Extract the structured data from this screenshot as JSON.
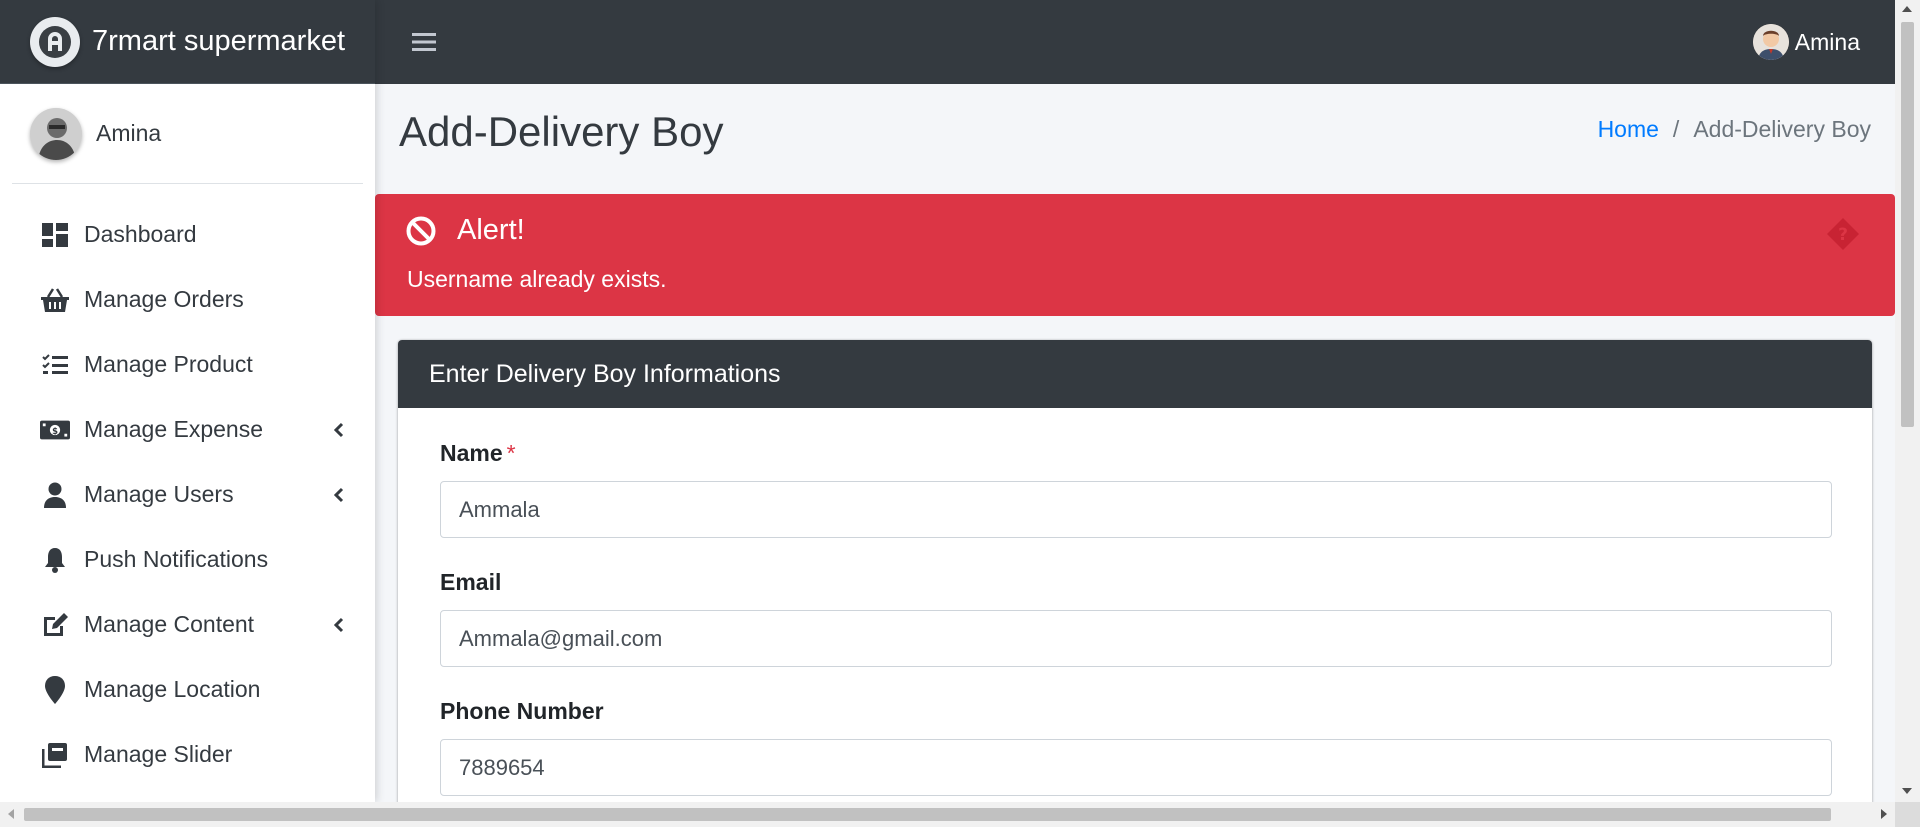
{
  "brand": {
    "name": "7rmart supermarket"
  },
  "sidebar": {
    "user": "Amina",
    "items": [
      {
        "label": "Dashboard",
        "icon": "dashboard-icon",
        "has_submenu": false
      },
      {
        "label": "Manage Orders",
        "icon": "basket-icon",
        "has_submenu": false
      },
      {
        "label": "Manage Product",
        "icon": "tasks-list-icon",
        "has_submenu": false
      },
      {
        "label": "Manage Expense",
        "icon": "money-bill-icon",
        "has_submenu": true
      },
      {
        "label": "Manage Users",
        "icon": "user-icon",
        "has_submenu": true
      },
      {
        "label": "Push Notifications",
        "icon": "bell-icon",
        "has_submenu": false
      },
      {
        "label": "Manage Content",
        "icon": "edit-icon",
        "has_submenu": true
      },
      {
        "label": "Manage Location",
        "icon": "map-marker-icon",
        "has_submenu": false
      },
      {
        "label": "Manage Slider",
        "icon": "slider-icon",
        "has_submenu": false
      }
    ]
  },
  "topbar": {
    "user": "Amina"
  },
  "page": {
    "title": "Add-Delivery Boy",
    "breadcrumb": {
      "home": "Home",
      "separator": "/",
      "current": "Add-Delivery Boy"
    }
  },
  "alert": {
    "title": "Alert!",
    "message": "Username already exists.",
    "color": "#dc3545"
  },
  "form": {
    "header": "Enter Delivery Boy Informations",
    "fields": {
      "name": {
        "label": "Name",
        "required_mark": "*",
        "value": "Ammala"
      },
      "email": {
        "label": "Email",
        "value": "Ammala@gmail.com"
      },
      "phone": {
        "label": "Phone Number",
        "value": "7889654"
      }
    }
  },
  "colors": {
    "navbar": "#343a40",
    "link": "#007bff",
    "danger": "#dc3545",
    "sidebar_bg": "#ffffff"
  }
}
